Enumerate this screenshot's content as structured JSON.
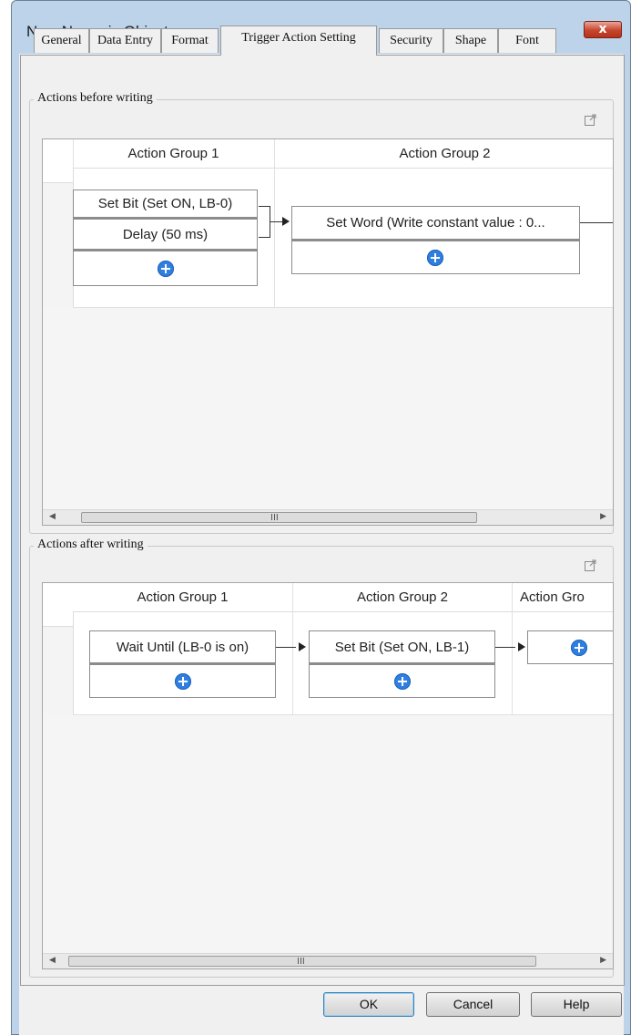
{
  "window": {
    "title": "New Numeric Object",
    "close_label": "x"
  },
  "tabs": [
    {
      "label": "General"
    },
    {
      "label": "Data Entry"
    },
    {
      "label": "Format"
    },
    {
      "label": "Trigger Action Setting"
    },
    {
      "label": "Security"
    },
    {
      "label": "Shape"
    },
    {
      "label": "Font"
    }
  ],
  "active_tab": "Trigger Action Setting",
  "before": {
    "label": "Actions before writing",
    "columns": [
      "Action Group 1",
      "Action Group 2"
    ],
    "group1_actions": [
      "Set Bit (Set ON, LB-0)",
      "Delay (50 ms)"
    ],
    "group2_actions": [
      "Set Word (Write constant value : 0..."
    ],
    "scroll_grip": "III"
  },
  "after": {
    "label": "Actions after writing",
    "columns": [
      "Action Group 1",
      "Action Group 2",
      "Action Gro"
    ],
    "group1_actions": [
      "Wait Until (LB-0 is on)"
    ],
    "group2_actions": [
      "Set Bit (Set ON, LB-1)"
    ],
    "scroll_grip": "III"
  },
  "buttons": {
    "ok": "OK",
    "cancel": "Cancel",
    "help": "Help"
  },
  "colors": {
    "add_icon": "#2f7fe0",
    "window_frame": "#bcd3ea",
    "close_button": "#c7452e"
  }
}
